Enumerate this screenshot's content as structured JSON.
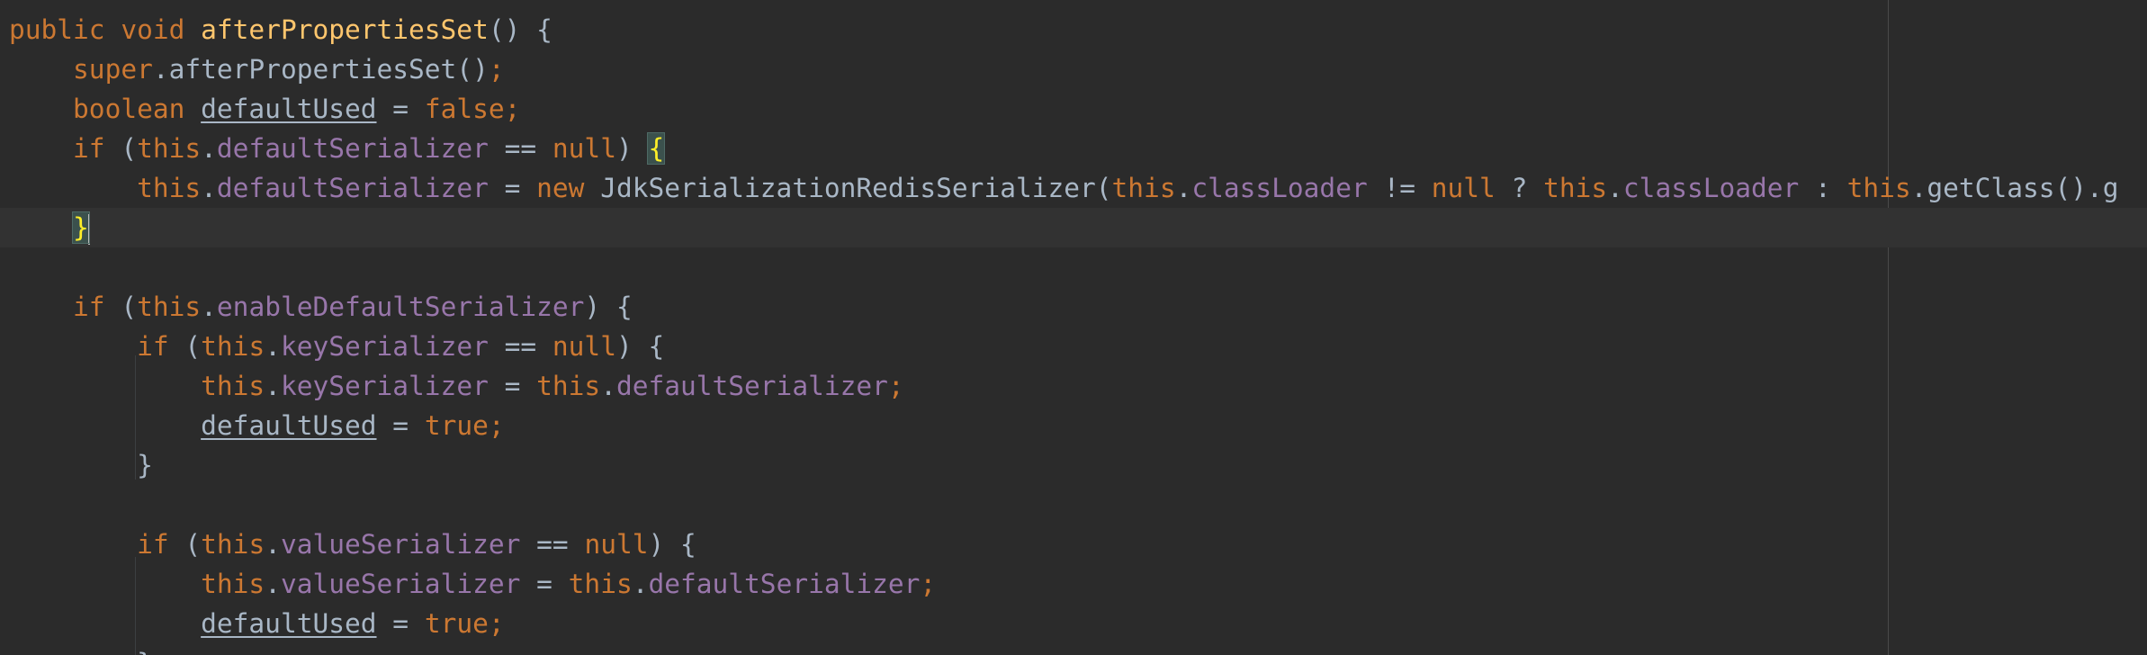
{
  "editor": {
    "lines": [
      [
        {
          "t": "public void ",
          "c": "kw"
        },
        {
          "t": "afterPropertiesSet",
          "c": "fn"
        },
        {
          "t": "() {",
          "c": "id"
        }
      ],
      [
        {
          "t": "    ",
          "c": "id"
        },
        {
          "t": "super",
          "c": "kw"
        },
        {
          "t": ".afterPropertiesSet()",
          "c": "id"
        },
        {
          "t": ";",
          "c": "kw"
        }
      ],
      [
        {
          "t": "    ",
          "c": "id"
        },
        {
          "t": "boolean ",
          "c": "kw"
        },
        {
          "t": "defaultUsed",
          "c": "id",
          "u": true
        },
        {
          "t": " = ",
          "c": "id"
        },
        {
          "t": "false;",
          "c": "kw"
        }
      ],
      [
        {
          "t": "    ",
          "c": "id"
        },
        {
          "t": "if ",
          "c": "kw"
        },
        {
          "t": "(",
          "c": "id"
        },
        {
          "t": "this",
          "c": "kw"
        },
        {
          "t": ".",
          "c": "id"
        },
        {
          "t": "defaultSerializer",
          "c": "fld"
        },
        {
          "t": " == ",
          "c": "id"
        },
        {
          "t": "null",
          "c": "kw"
        },
        {
          "t": ") ",
          "c": "id"
        },
        {
          "t": "{",
          "c": "brace"
        }
      ],
      [
        {
          "t": "        ",
          "c": "id"
        },
        {
          "t": "this",
          "c": "kw"
        },
        {
          "t": ".",
          "c": "id"
        },
        {
          "t": "defaultSerializer",
          "c": "fld"
        },
        {
          "t": " = ",
          "c": "id"
        },
        {
          "t": "new ",
          "c": "kw"
        },
        {
          "t": "JdkSerializationRedisSerializer(",
          "c": "id"
        },
        {
          "t": "this",
          "c": "kw"
        },
        {
          "t": ".",
          "c": "id"
        },
        {
          "t": "classLoader",
          "c": "fld"
        },
        {
          "t": " != ",
          "c": "id"
        },
        {
          "t": "null",
          "c": "kw"
        },
        {
          "t": " ? ",
          "c": "id"
        },
        {
          "t": "this",
          "c": "kw"
        },
        {
          "t": ".",
          "c": "id"
        },
        {
          "t": "classLoader",
          "c": "fld"
        },
        {
          "t": " : ",
          "c": "id"
        },
        {
          "t": "this",
          "c": "kw"
        },
        {
          "t": ".getClass().g",
          "c": "id"
        }
      ],
      [
        {
          "t": "    ",
          "c": "id"
        },
        {
          "t": "}",
          "c": "brace"
        },
        {
          "t": "",
          "c": "caret"
        }
      ],
      [],
      [
        {
          "t": "    ",
          "c": "id"
        },
        {
          "t": "if ",
          "c": "kw"
        },
        {
          "t": "(",
          "c": "id"
        },
        {
          "t": "this",
          "c": "kw"
        },
        {
          "t": ".",
          "c": "id"
        },
        {
          "t": "enableDefaultSerializer",
          "c": "fld"
        },
        {
          "t": ") {",
          "c": "id"
        }
      ],
      [
        {
          "t": "        ",
          "c": "id"
        },
        {
          "t": "if ",
          "c": "kw"
        },
        {
          "t": "(",
          "c": "id"
        },
        {
          "t": "this",
          "c": "kw"
        },
        {
          "t": ".",
          "c": "id"
        },
        {
          "t": "keySerializer",
          "c": "fld"
        },
        {
          "t": " == ",
          "c": "id"
        },
        {
          "t": "null",
          "c": "kw"
        },
        {
          "t": ") {",
          "c": "id"
        }
      ],
      [
        {
          "t": "            ",
          "c": "id"
        },
        {
          "t": "this",
          "c": "kw"
        },
        {
          "t": ".",
          "c": "id"
        },
        {
          "t": "keySerializer",
          "c": "fld"
        },
        {
          "t": " = ",
          "c": "id"
        },
        {
          "t": "this",
          "c": "kw"
        },
        {
          "t": ".",
          "c": "id"
        },
        {
          "t": "defaultSerializer",
          "c": "fld"
        },
        {
          "t": ";",
          "c": "kw"
        }
      ],
      [
        {
          "t": "            ",
          "c": "id"
        },
        {
          "t": "defaultUsed",
          "c": "id",
          "u": true
        },
        {
          "t": " = ",
          "c": "id"
        },
        {
          "t": "true;",
          "c": "kw"
        }
      ],
      [
        {
          "t": "        }",
          "c": "id"
        }
      ],
      [],
      [
        {
          "t": "        ",
          "c": "id"
        },
        {
          "t": "if ",
          "c": "kw"
        },
        {
          "t": "(",
          "c": "id"
        },
        {
          "t": "this",
          "c": "kw"
        },
        {
          "t": ".",
          "c": "id"
        },
        {
          "t": "valueSerializer",
          "c": "fld"
        },
        {
          "t": " == ",
          "c": "id"
        },
        {
          "t": "null",
          "c": "kw"
        },
        {
          "t": ") {",
          "c": "id"
        }
      ],
      [
        {
          "t": "            ",
          "c": "id"
        },
        {
          "t": "this",
          "c": "kw"
        },
        {
          "t": ".",
          "c": "id"
        },
        {
          "t": "valueSerializer",
          "c": "fld"
        },
        {
          "t": " = ",
          "c": "id"
        },
        {
          "t": "this",
          "c": "kw"
        },
        {
          "t": ".",
          "c": "id"
        },
        {
          "t": "defaultSerializer",
          "c": "fld"
        },
        {
          "t": ";",
          "c": "kw"
        }
      ],
      [
        {
          "t": "            ",
          "c": "id"
        },
        {
          "t": "defaultUsed",
          "c": "id",
          "u": true
        },
        {
          "t": " = ",
          "c": "id"
        },
        {
          "t": "true;",
          "c": "kw"
        }
      ],
      [
        {
          "t": "        }",
          "c": "id"
        }
      ]
    ],
    "current_line": 6,
    "colors": {
      "background": "#2b2b2b",
      "keyword": "#cc7832",
      "method": "#ffc66d",
      "field": "#9876aa",
      "identifier": "#a9b7c6",
      "brace_match": "#ffef28",
      "current_line": "#323232"
    }
  }
}
